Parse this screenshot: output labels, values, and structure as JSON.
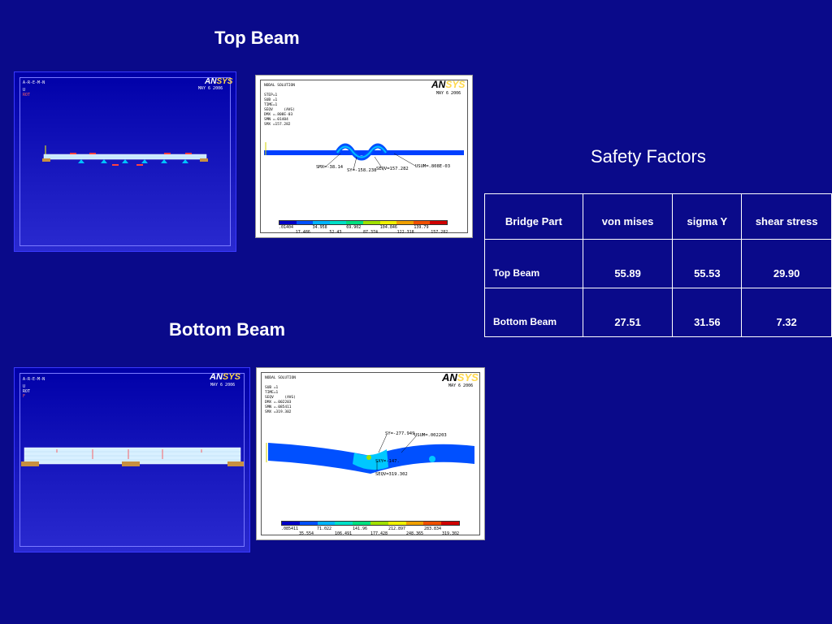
{
  "headings": {
    "top_beam": "Top Beam",
    "bottom_beam": "Bottom Beam",
    "safety_factors": "Safety Factors"
  },
  "table": {
    "headers": [
      "Bridge Part",
      "von mises",
      "sigma Y",
      "shear stress"
    ],
    "rows": [
      {
        "part": "Top Beam",
        "von_mises": "55.89",
        "sigma_y": "55.53",
        "shear_stress": "29.90"
      },
      {
        "part": "Bottom Beam",
        "von_mises": "27.51",
        "sigma_y": "31.56",
        "shear_stress": "7.32"
      }
    ]
  },
  "ansys": {
    "logo_an": "AN",
    "logo_sys": "SYS",
    "date_may": "MAY  6 2006",
    "model_tag": "A-R-E-M-N",
    "model_u": "U",
    "model_rot": "ROT",
    "model_f": "F"
  },
  "top_result": {
    "header": "NODAL SOLUTION\n\nSTEP=1\nSUB =1\nTIME=1\nSEQV     (AVG)\nDMX =.808E-03\nSMN =.01404\nSMX =157.282",
    "labels": {
      "smx_pt": "SMX=-38.14",
      "smn_pt": "SY=-158.238",
      "seqv": "SEQV=157.282",
      "usum": "USUM=.808E-03"
    },
    "legend_top": [
      ".01404",
      "34.958",
      "69.902",
      "104.846",
      "139.79"
    ],
    "legend_bottom": [
      "17.486",
      "52.43",
      "87.374",
      "122.318",
      "157.282"
    ]
  },
  "bottom_result": {
    "header": "NODAL SOLUTION\n\nSUB =1\nTIME=1\nSEQV     (AVG)\nDMX =.002203\nSMN =.085411\nSMX =319.302",
    "labels": {
      "sy": "SY=-277.949",
      "usum": "USUM=.002203",
      "sxy": "SXY=-147.",
      "seqv": "SEQV=319.302"
    },
    "legend_top": [
      ".085411",
      "71.022",
      "141.96",
      "212.897",
      "283.834"
    ],
    "legend_bottom": [
      "35.554",
      "106.491",
      "177.428",
      "248.365",
      "319.302"
    ]
  },
  "colors": {
    "background": "#0a0a8a",
    "legend": [
      "#0000c8",
      "#0050ff",
      "#00b4ff",
      "#00e0c8",
      "#00e080",
      "#a0e000",
      "#f0f000",
      "#f0a000",
      "#f05000",
      "#d00000"
    ]
  }
}
